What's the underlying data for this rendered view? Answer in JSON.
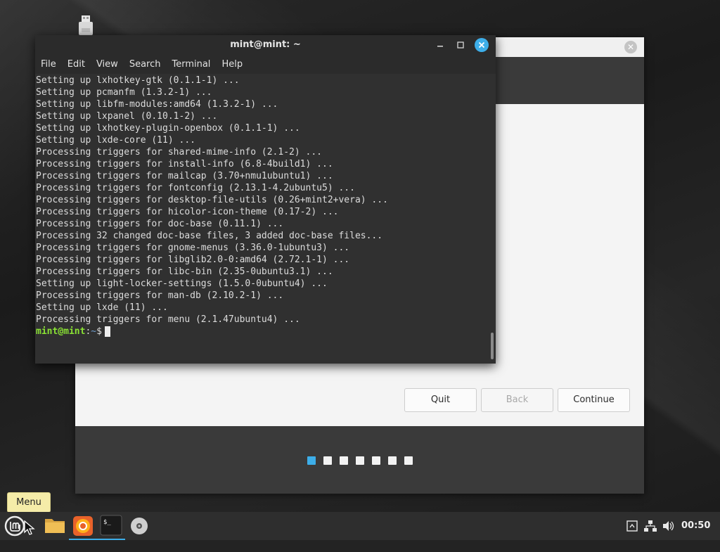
{
  "terminal": {
    "title": "mint@mint: ~",
    "menu": [
      "File",
      "Edit",
      "View",
      "Search",
      "Terminal",
      "Help"
    ],
    "lines": [
      "Setting up lxhotkey-gtk (0.1.1-1) ...",
      "Setting up pcmanfm (1.3.2-1) ...",
      "Setting up libfm-modules:amd64 (1.3.2-1) ...",
      "Setting up lxpanel (0.10.1-2) ...",
      "Setting up lxhotkey-plugin-openbox (0.1.1-1) ...",
      "Setting up lxde-core (11) ...",
      "Processing triggers for shared-mime-info (2.1-2) ...",
      "Processing triggers for install-info (6.8-4build1) ...",
      "Processing triggers for mailcap (3.70+nmu1ubuntu1) ...",
      "Processing triggers for fontconfig (2.13.1-4.2ubuntu5) ...",
      "Processing triggers for desktop-file-utils (0.26+mint2+vera) ...",
      "Processing triggers for hicolor-icon-theme (0.17-2) ...",
      "Processing triggers for doc-base (0.11.1) ...",
      "Processing 32 changed doc-base files, 3 added doc-base files...",
      "Processing triggers for gnome-menus (3.36.0-1ubuntu3) ...",
      "Processing triggers for libglib2.0-0:amd64 (2.72.1-1) ...",
      "Processing triggers for libc-bin (2.35-0ubuntu3.1) ...",
      "Setting up light-locker-settings (1.5.0-0ubuntu4) ...",
      "Processing triggers for man-db (2.10.2-1) ...",
      "Setting up lxde (11) ...",
      "Processing triggers for menu (2.1.47ubuntu4) ..."
    ],
    "prompt_user": "mint@mint",
    "prompt_sep": ":",
    "prompt_path": "~",
    "prompt_symbol": "$"
  },
  "installer": {
    "buttons": {
      "quit": "Quit",
      "back": "Back",
      "continue": "Continue"
    },
    "steps_total": 7,
    "step_active": 1
  },
  "tooltip": "Menu",
  "taskbar": {
    "items": [
      "menu-icon",
      "files-icon",
      "firefox-icon",
      "terminal-icon",
      "disc-icon"
    ],
    "clock": "00:50"
  },
  "colors": {
    "accent": "#3daee9",
    "prompt_user": "#8ae234",
    "prompt_path": "#729fcf"
  }
}
